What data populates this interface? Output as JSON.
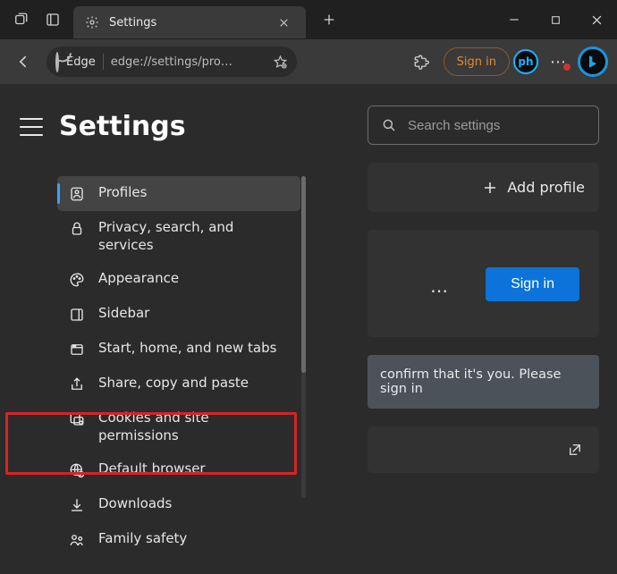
{
  "titlebar": {
    "tab_title": "Settings"
  },
  "toolbar": {
    "edge_label": "Edge",
    "url": "edge://settings/pro…",
    "signin_label": "Sign in",
    "ph_badge": "ph"
  },
  "page": {
    "title": "Settings"
  },
  "sidebar": {
    "items": [
      {
        "label": "Profiles"
      },
      {
        "label": "Privacy, search, and services"
      },
      {
        "label": "Appearance"
      },
      {
        "label": "Sidebar"
      },
      {
        "label": "Start, home, and new tabs"
      },
      {
        "label": "Share, copy and paste"
      },
      {
        "label": "Cookies and site permissions"
      },
      {
        "label": "Default browser"
      },
      {
        "label": "Downloads"
      },
      {
        "label": "Family safety"
      }
    ]
  },
  "right": {
    "search_placeholder": "Search settings",
    "add_profile": "Add profile",
    "signin_button": "Sign in",
    "confirm_text": "confirm that it's you. Please sign in"
  }
}
